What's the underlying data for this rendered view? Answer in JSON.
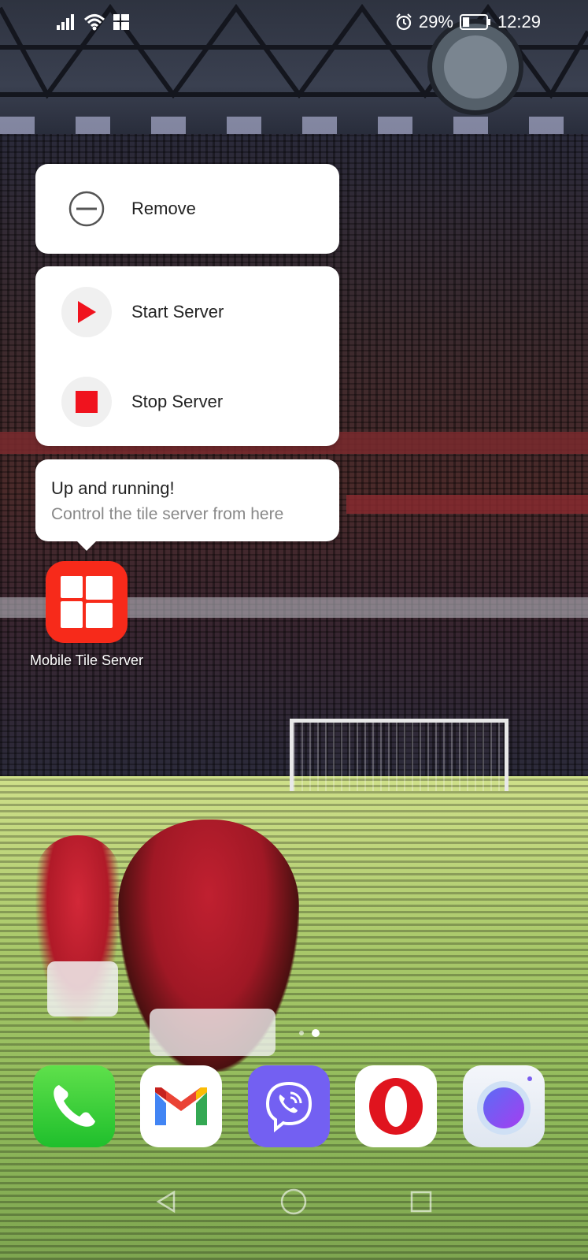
{
  "status_bar": {
    "alarm_icon": "alarm-icon",
    "battery_percent": "29%",
    "time": "12:29",
    "battery_level": 0.29
  },
  "menu": {
    "remove_label": "Remove",
    "start_server_label": "Start Server",
    "stop_server_label": "Stop Server"
  },
  "tooltip": {
    "title": "Up and running!",
    "subtitle": "Control the tile server from here"
  },
  "app": {
    "label": "Mobile Tile Server",
    "icon_color": "#f72a1a"
  },
  "pages": {
    "count": 2,
    "active": 2
  },
  "dock": [
    "phone-icon",
    "gmail-icon",
    "viber-icon",
    "opera-icon",
    "browser-icon"
  ],
  "colors": {
    "accent_red": "#f0131e"
  }
}
